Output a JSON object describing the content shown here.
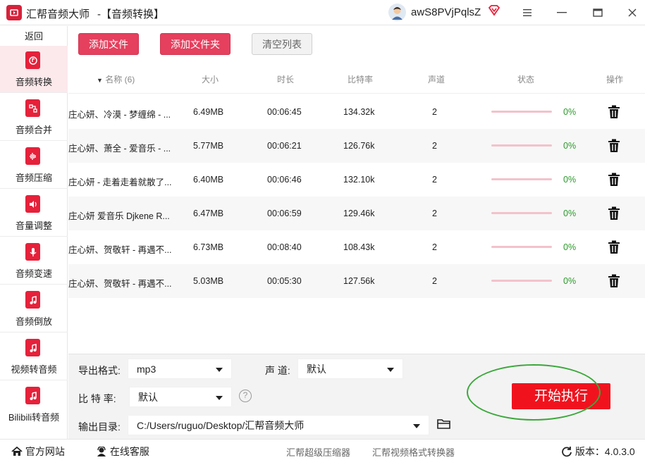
{
  "titlebar": {
    "app_title": "汇帮音频大师",
    "page_title": "-【音频转换】",
    "username": "awS8PVjPqlsZ"
  },
  "sidebar": {
    "back_label": "返回",
    "items": [
      {
        "label": "音频转换",
        "icon": "music-convert-icon",
        "active": true
      },
      {
        "label": "音频合并",
        "icon": "merge-icon",
        "active": false
      },
      {
        "label": "音频压缩",
        "icon": "compress-icon",
        "active": false
      },
      {
        "label": "音量调整",
        "icon": "volume-icon",
        "active": false
      },
      {
        "label": "音频变速",
        "icon": "microphone-icon",
        "active": false
      },
      {
        "label": "音频倒放",
        "icon": "music-note-icon",
        "active": false
      },
      {
        "label": "视频转音频",
        "icon": "music-note-icon",
        "active": false
      },
      {
        "label": "Bilibili转音频",
        "icon": "music-note-icon",
        "active": false
      }
    ]
  },
  "toolbar": {
    "add_file": "添加文件",
    "add_folder": "添加文件夹",
    "clear_list": "清空列表"
  },
  "table": {
    "headers": {
      "name": "名称 (6)",
      "size": "大小",
      "duration": "时长",
      "bitrate": "比特率",
      "channels": "声道",
      "status": "状态",
      "action": "操作"
    },
    "rows": [
      {
        "name": "庄心妍、冷漠 - 梦缠绵 - ...",
        "size": "6.49MB",
        "duration": "00:06:45",
        "bitrate": "134.32k",
        "channels": "2",
        "progress": 0,
        "percent": "0%"
      },
      {
        "name": "庄心妍、萧全 - 爱音乐 - ...",
        "size": "5.77MB",
        "duration": "00:06:21",
        "bitrate": "126.76k",
        "channels": "2",
        "progress": 0,
        "percent": "0%"
      },
      {
        "name": "庄心妍 - 走着走着就散了...",
        "size": "6.40MB",
        "duration": "00:06:46",
        "bitrate": "132.10k",
        "channels": "2",
        "progress": 0,
        "percent": "0%"
      },
      {
        "name": "庄心妍 爱音乐 Djkene R...",
        "size": "6.47MB",
        "duration": "00:06:59",
        "bitrate": "129.46k",
        "channels": "2",
        "progress": 0,
        "percent": "0%"
      },
      {
        "name": "庄心妍、贺敬轩 - 再遇不...",
        "size": "6.73MB",
        "duration": "00:08:40",
        "bitrate": "108.43k",
        "channels": "2",
        "progress": 0,
        "percent": "0%"
      },
      {
        "name": "庄心妍、贺敬轩 - 再遇不...",
        "size": "5.03MB",
        "duration": "00:05:30",
        "bitrate": "127.56k",
        "channels": "2",
        "progress": 0,
        "percent": "0%"
      }
    ]
  },
  "settings": {
    "format_label": "导出格式:",
    "format_value": "mp3",
    "channel_label": "声  道:",
    "channel_value": "默认",
    "bitrate_label": "比 特 率:",
    "bitrate_value": "默认",
    "output_label": "输出目录:",
    "output_value": "C:/Users/ruguo/Desktop/汇帮音频大师",
    "start_label": "开始执行"
  },
  "statusbar": {
    "website": "官方网站",
    "support": "在线客服",
    "link1": "汇帮超级压缩器",
    "link2": "汇帮视频格式转换器",
    "version": "版本：4.0.3.0"
  },
  "colors": {
    "accent": "#e5405e",
    "start_button": "#f0131e",
    "percent_text": "#2a9a2a"
  }
}
